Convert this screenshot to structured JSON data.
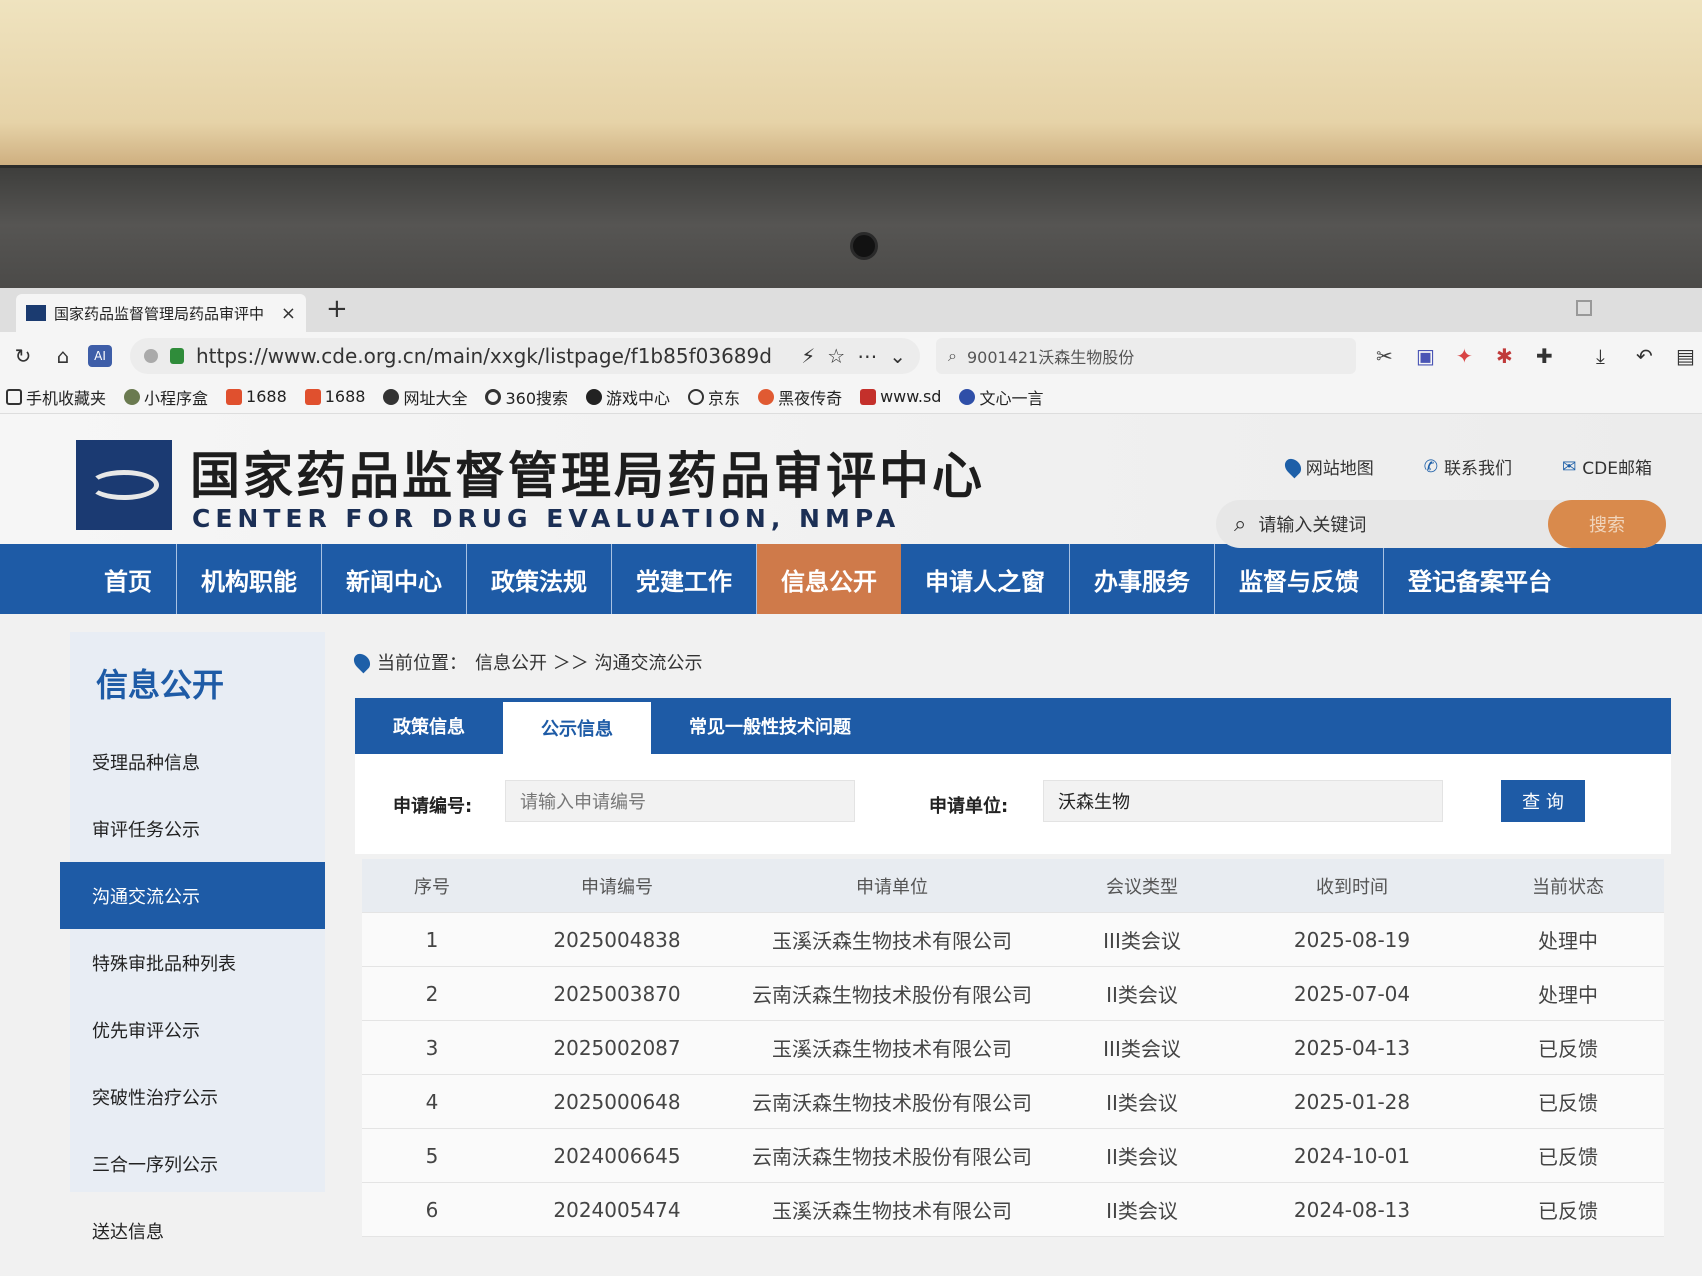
{
  "browser": {
    "tab_title": "国家药品监督管理局药品审评中",
    "tab_close": "×",
    "new_tab": "+",
    "url": "https://www.cde.org.cn/main/xxgk/listpage/f1b85f03689d",
    "search_value": "9001421沃森生物股份",
    "ai_label": "AI",
    "bookmarks": [
      "手机收藏夹",
      "小程序盒",
      "1688",
      "1688",
      "网址大全",
      "360搜索",
      "游戏中心",
      "京东",
      "黑夜传奇",
      "www.sd",
      "文心一言"
    ]
  },
  "site": {
    "title": "国家药品监督管理局药品审评中心",
    "subtitle": "CENTER FOR DRUG EVALUATION, NMPA",
    "links": [
      "网站地图",
      "联系我们",
      "CDE邮箱"
    ],
    "search_placeholder": "请输入关键词",
    "search_button": "搜索"
  },
  "nav": [
    "首页",
    "机构职能",
    "新闻中心",
    "政策法规",
    "党建工作",
    "信息公开",
    "申请人之窗",
    "办事服务",
    "监督与反馈",
    "登记备案平台"
  ],
  "nav_active": "信息公开",
  "sidebar": {
    "title": "信息公开",
    "items": [
      "受理品种信息",
      "审评任务公示",
      "沟通交流公示",
      "特殊审批品种列表",
      "优先审评公示",
      "突破性治疗公示",
      "三合一序列公示",
      "送达信息"
    ],
    "active": "沟通交流公示"
  },
  "breadcrumb": {
    "prefix": "当前位置：",
    "path": "信息公开 ＞＞ 沟通交流公示"
  },
  "content_tabs": [
    "政策信息",
    "公示信息",
    "常见一般性技术问题"
  ],
  "filter": {
    "app_no_label": "申请编号:",
    "app_no_placeholder": "请输入申请编号",
    "applicant_label": "申请单位:",
    "applicant_value": "沃森生物",
    "query_button": "查 询"
  },
  "table": {
    "headers": [
      "序号",
      "申请编号",
      "申请单位",
      "会议类型",
      "收到时间",
      "当前状态"
    ],
    "rows": [
      [
        "1",
        "2025004838",
        "玉溪沃森生物技术有限公司",
        "III类会议",
        "2025-08-19",
        "处理中"
      ],
      [
        "2",
        "2025003870",
        "云南沃森生物技术股份有限公司",
        "II类会议",
        "2025-07-04",
        "处理中"
      ],
      [
        "3",
        "2025002087",
        "玉溪沃森生物技术有限公司",
        "III类会议",
        "2025-04-13",
        "已反馈"
      ],
      [
        "4",
        "2025000648",
        "云南沃森生物技术股份有限公司",
        "II类会议",
        "2025-01-28",
        "已反馈"
      ],
      [
        "5",
        "2024006645",
        "云南沃森生物技术股份有限公司",
        "II类会议",
        "2024-10-01",
        "已反馈"
      ],
      [
        "6",
        "2024005474",
        "玉溪沃森生物技术有限公司",
        "II类会议",
        "2024-08-13",
        "已反馈"
      ]
    ]
  },
  "colors": {
    "brand_blue": "#1e5ba6",
    "active_orange": "#cf7a4a",
    "search_orange": "#d98a4c"
  }
}
